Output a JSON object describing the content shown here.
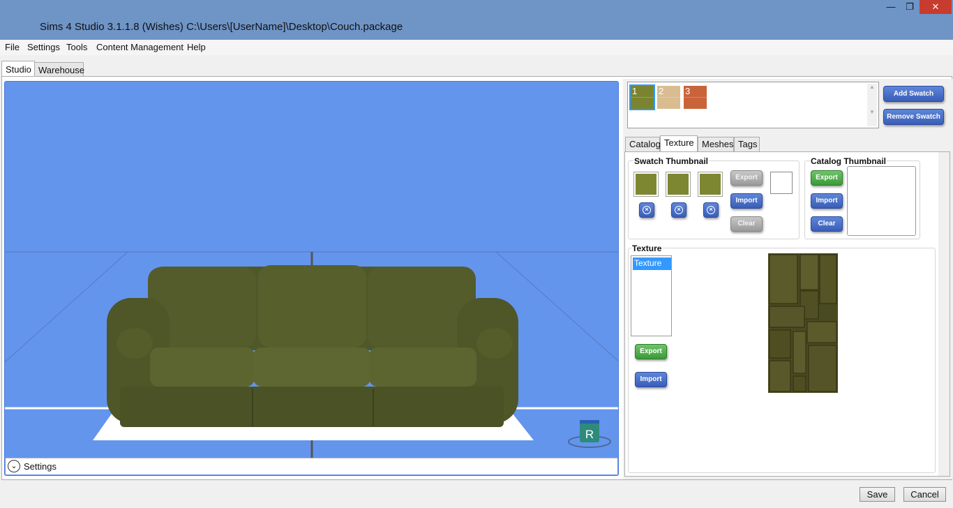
{
  "window": {
    "title": "Sims 4 Studio 3.1.1.8 (Wishes)  C:\\Users\\[UserName]\\Desktop\\Couch.package",
    "min": "—",
    "max": "❐",
    "close": "✕"
  },
  "menu": [
    "File",
    "Settings",
    "Tools",
    "Content Management",
    "Help"
  ],
  "top_tabs": [
    "Studio",
    "Warehouse"
  ],
  "viewport": {
    "settings_label": "Settings",
    "badge_letter": "R"
  },
  "swatches": {
    "items": [
      {
        "number": "1",
        "color": "#7a8430",
        "selected": true
      },
      {
        "number": "2",
        "color": "#d9bd91",
        "selected": false
      },
      {
        "number": "3",
        "color": "#c9643a",
        "selected": false
      }
    ],
    "add_label": "Add Swatch",
    "remove_label": "Remove Swatch"
  },
  "sub_tabs": [
    "Catalog",
    "Texture",
    "Meshes",
    "Tags"
  ],
  "swatch_thumbnail": {
    "title": "Swatch Thumbnail",
    "export_label": "Export",
    "import_label": "Import",
    "clear_label": "Clear"
  },
  "catalog_thumbnail": {
    "title": "Catalog Thumbnail",
    "export_label": "Export",
    "import_label": "Import",
    "clear_label": "Clear"
  },
  "texture": {
    "title": "Texture",
    "list_items": [
      "Texture"
    ],
    "export_label": "Export",
    "import_label": "Import"
  },
  "footer": {
    "save_label": "Save",
    "cancel_label": "Cancel"
  }
}
